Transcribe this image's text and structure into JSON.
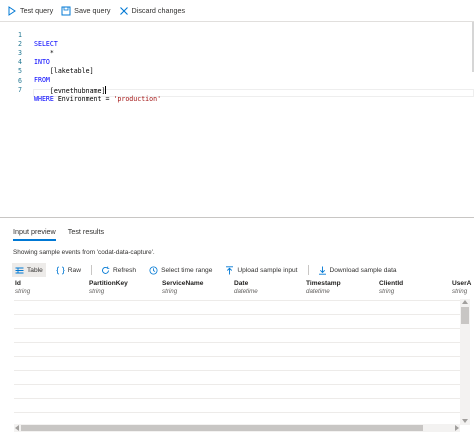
{
  "toolbar": {
    "test_query": "Test query",
    "save_query": "Save query",
    "discard_changes": "Discard changes"
  },
  "editor": {
    "lines": [
      {
        "num": "1",
        "kw": "SELECT",
        "text": "",
        "str": ""
      },
      {
        "num": "2",
        "kw": "",
        "text": "    *",
        "str": ""
      },
      {
        "num": "3",
        "kw": "INTO",
        "text": "",
        "str": ""
      },
      {
        "num": "4",
        "kw": "",
        "text": "    [laketable]",
        "str": ""
      },
      {
        "num": "5",
        "kw": "FROM",
        "text": "",
        "str": ""
      },
      {
        "num": "6",
        "kw": "",
        "text": "    [evnethubname]",
        "str": ""
      },
      {
        "num": "7",
        "kw": "WHERE",
        "text": " Environment = ",
        "str": "'production'"
      }
    ]
  },
  "panel": {
    "tabs": [
      "Input preview",
      "Test results"
    ],
    "info": "Showing sample events from 'codat-data-capture'.",
    "subbar": {
      "table": "Table",
      "raw": "Raw",
      "refresh": "Refresh",
      "select_time_range": "Select time range",
      "upload_sample_input": "Upload sample input",
      "download_sample_data": "Download sample data"
    },
    "columns": [
      {
        "name": "Id",
        "type": "string"
      },
      {
        "name": "PartitionKey",
        "type": "string"
      },
      {
        "name": "ServiceName",
        "type": "string"
      },
      {
        "name": "Date",
        "type": "datetime"
      },
      {
        "name": "Timestamp",
        "type": "datetime"
      },
      {
        "name": "ClientId",
        "type": "string"
      },
      {
        "name": "UserA",
        "type": "string"
      }
    ]
  },
  "colors": {
    "accent": "#0078d4",
    "keyword": "#0000ff",
    "string": "#a31515",
    "line_number": "#237893"
  }
}
